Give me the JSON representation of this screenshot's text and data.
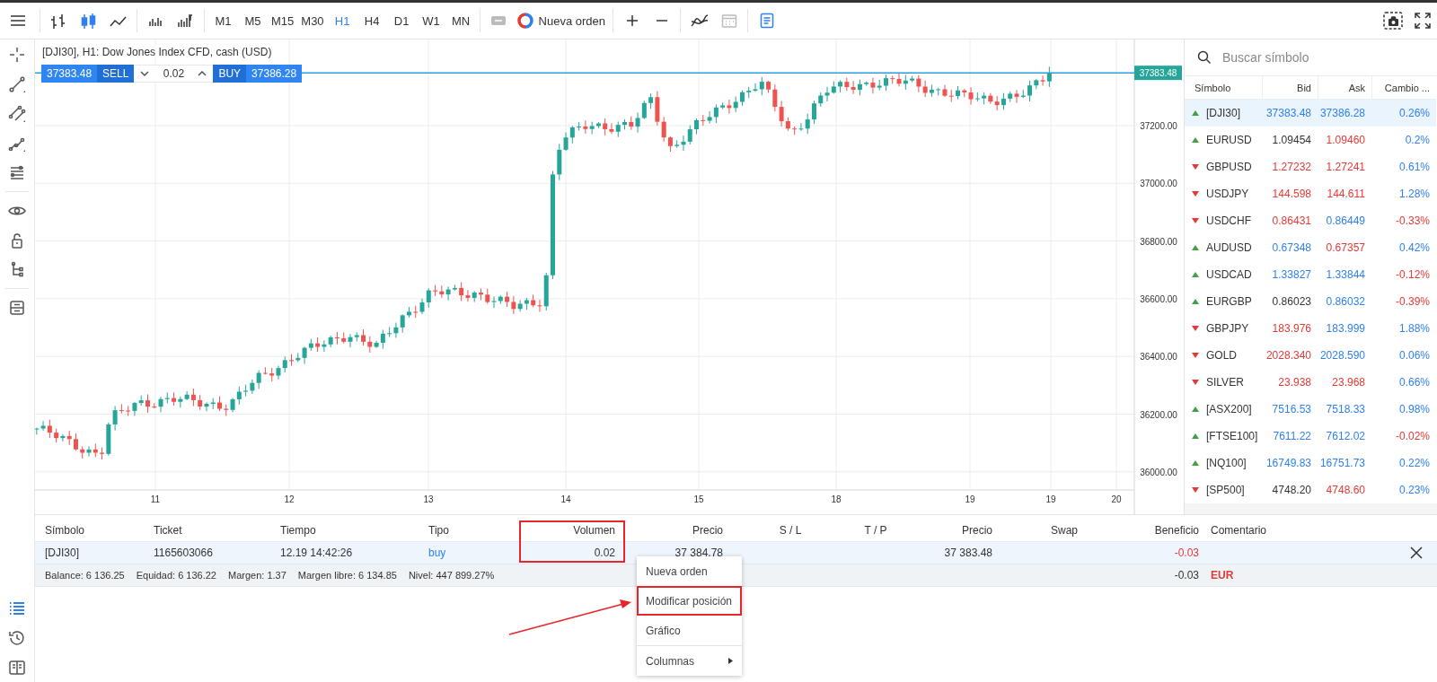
{
  "toolbar": {
    "chart_types": [
      {
        "selected": false
      },
      {
        "selected": true
      },
      {
        "selected": false
      }
    ],
    "timeframes": [
      {
        "label": "M1",
        "selected": false
      },
      {
        "label": "M5",
        "selected": false
      },
      {
        "label": "M15",
        "selected": false
      },
      {
        "label": "M30",
        "selected": false
      },
      {
        "label": "H1",
        "selected": true
      },
      {
        "label": "H4",
        "selected": false
      },
      {
        "label": "D1",
        "selected": false
      },
      {
        "label": "W1",
        "selected": false
      },
      {
        "label": "MN",
        "selected": false
      }
    ],
    "one_click": {
      "disabled": true
    },
    "new_order": "Nueva orden",
    "date_picker": {
      "disabled": true
    },
    "trade_panel": {
      "on": true
    }
  },
  "chart": {
    "title": "[DJI30], H1: Dow Jones Index CFD, cash (USD)",
    "sell_price": "37383.48",
    "sell_label": "SELL",
    "volume": "0.02",
    "buy_label": "BUY",
    "buy_price": "37386.28",
    "price_ticks": [
      "37200.00",
      "37000.00",
      "36800.00",
      "36600.00",
      "36400.00",
      "36200.00",
      "36000.00"
    ],
    "current_price": "37383.48",
    "date_labels": [
      "11",
      "12",
      "13",
      "14",
      "15",
      "18",
      "19",
      "19",
      "20"
    ]
  },
  "watchlist": {
    "placeholder": "Buscar símbolo",
    "columns": [
      "Símbolo",
      "Bid",
      "Ask",
      "Cambio ..."
    ],
    "rows": [
      {
        "symbol": "[DJI30]",
        "rising": true,
        "selected": true,
        "bid": {
          "text": "37383.48",
          "color": "#2f80ed"
        },
        "ask": {
          "text": "37386.28",
          "color": "#2f80ed"
        },
        "change": {
          "text": "0.26%",
          "color": "#2f80ed"
        }
      },
      {
        "symbol": "EURUSD",
        "rising": true,
        "selected": false,
        "bid": {
          "text": "1.09454",
          "color": "#333333"
        },
        "ask": {
          "text": "1.09460",
          "color": "#e53935"
        },
        "change": {
          "text": "0.2%",
          "color": "#2f80ed"
        }
      },
      {
        "symbol": "GBPUSD",
        "rising": false,
        "selected": false,
        "bid": {
          "text": "1.27232",
          "color": "#e53935"
        },
        "ask": {
          "text": "1.27241",
          "color": "#e53935"
        },
        "change": {
          "text": "0.61%",
          "color": "#2f80ed"
        }
      },
      {
        "symbol": "USDJPY",
        "rising": false,
        "selected": false,
        "bid": {
          "text": "144.598",
          "color": "#e53935"
        },
        "ask": {
          "text": "144.611",
          "color": "#e53935"
        },
        "change": {
          "text": "1.28%",
          "color": "#2f80ed"
        }
      },
      {
        "symbol": "USDCHF",
        "rising": false,
        "selected": false,
        "bid": {
          "text": "0.86431",
          "color": "#e53935"
        },
        "ask": {
          "text": "0.86449",
          "color": "#2f80ed"
        },
        "change": {
          "text": "-0.33%",
          "color": "#e53935"
        }
      },
      {
        "symbol": "AUDUSD",
        "rising": true,
        "selected": false,
        "bid": {
          "text": "0.67348",
          "color": "#2f80ed"
        },
        "ask": {
          "text": "0.67357",
          "color": "#e53935"
        },
        "change": {
          "text": "0.42%",
          "color": "#2f80ed"
        }
      },
      {
        "symbol": "USDCAD",
        "rising": true,
        "selected": false,
        "bid": {
          "text": "1.33827",
          "color": "#2f80ed"
        },
        "ask": {
          "text": "1.33844",
          "color": "#2f80ed"
        },
        "change": {
          "text": "-0.12%",
          "color": "#e53935"
        }
      },
      {
        "symbol": "EURGBP",
        "rising": true,
        "selected": false,
        "bid": {
          "text": "0.86023",
          "color": "#333333"
        },
        "ask": {
          "text": "0.86032",
          "color": "#2f80ed"
        },
        "change": {
          "text": "-0.39%",
          "color": "#e53935"
        }
      },
      {
        "symbol": "GBPJPY",
        "rising": false,
        "selected": false,
        "bid": {
          "text": "183.976",
          "color": "#e53935"
        },
        "ask": {
          "text": "183.999",
          "color": "#2f80ed"
        },
        "change": {
          "text": "1.88%",
          "color": "#2f80ed"
        }
      },
      {
        "symbol": "GOLD",
        "rising": false,
        "selected": false,
        "bid": {
          "text": "2028.340",
          "color": "#e53935"
        },
        "ask": {
          "text": "2028.590",
          "color": "#2f80ed"
        },
        "change": {
          "text": "0.06%",
          "color": "#2f80ed"
        }
      },
      {
        "symbol": "SILVER",
        "rising": false,
        "selected": false,
        "bid": {
          "text": "23.938",
          "color": "#e53935"
        },
        "ask": {
          "text": "23.968",
          "color": "#e53935"
        },
        "change": {
          "text": "0.66%",
          "color": "#2f80ed"
        }
      },
      {
        "symbol": "[ASX200]",
        "rising": true,
        "selected": false,
        "bid": {
          "text": "7516.53",
          "color": "#2f80ed"
        },
        "ask": {
          "text": "7518.33",
          "color": "#2f80ed"
        },
        "change": {
          "text": "0.98%",
          "color": "#2f80ed"
        }
      },
      {
        "symbol": "[FTSE100]",
        "rising": true,
        "selected": false,
        "bid": {
          "text": "7611.22",
          "color": "#2f80ed"
        },
        "ask": {
          "text": "7612.02",
          "color": "#2f80ed"
        },
        "change": {
          "text": "-0.02%",
          "color": "#e53935"
        }
      },
      {
        "symbol": "[NQ100]",
        "rising": true,
        "selected": false,
        "bid": {
          "text": "16749.83",
          "color": "#2f80ed"
        },
        "ask": {
          "text": "16751.73",
          "color": "#2f80ed"
        },
        "change": {
          "text": "0.22%",
          "color": "#2f80ed"
        }
      },
      {
        "symbol": "[SP500]",
        "rising": false,
        "selected": false,
        "bid": {
          "text": "4748.20",
          "color": "#333333"
        },
        "ask": {
          "text": "4748.60",
          "color": "#e53935"
        },
        "change": {
          "text": "0.23%",
          "color": "#2f80ed"
        }
      }
    ]
  },
  "positions": {
    "columns": [
      {
        "label": "Símbolo",
        "annotated": false
      },
      {
        "label": "Ticket",
        "annotated": false
      },
      {
        "label": "Tiempo",
        "annotated": false
      },
      {
        "label": "Tipo",
        "annotated": false
      },
      {
        "label": "Volumen",
        "annotated": true
      },
      {
        "label": "Precio",
        "annotated": false
      },
      {
        "label": "S / L",
        "annotated": false
      },
      {
        "label": "T / P",
        "annotated": false
      },
      {
        "label": "Precio",
        "annotated": false
      },
      {
        "label": "Swap",
        "annotated": false
      },
      {
        "label": "Beneficio",
        "annotated": false
      },
      {
        "label": "Comentario",
        "annotated": false
      }
    ],
    "rows": [
      {
        "symbol": "[DJI30]",
        "ticket": "1165603066",
        "time": "12.19 14:42:26",
        "type": "buy",
        "buy_side": true,
        "volume": "0.02",
        "open_price": "37 384.78",
        "price": "37 383.48",
        "profit": "-0.03",
        "profit_negative": true,
        "closable": true
      }
    ],
    "summary": {
      "items": [
        "Balance: 6 136.25",
        "Equidad: 6 136.22",
        "Margen: 1.37",
        "Margen libre: 6 134.85",
        "Nivel: 447 899.27%"
      ],
      "profit": "-0.03",
      "currency": "EUR"
    }
  },
  "context_menu": {
    "items": [
      {
        "label": "Nueva orden",
        "annotated": false,
        "submenu": false
      },
      {
        "label": "Modificar posición",
        "annotated": true,
        "submenu": false
      },
      {
        "label": "Gráfico",
        "annotated": false,
        "submenu": false
      },
      {
        "label": "Columnas",
        "annotated": false,
        "submenu": true
      }
    ]
  },
  "bottom_tabs": [
    {
      "selected": true
    },
    {
      "selected": false
    },
    {
      "selected": false
    }
  ]
}
